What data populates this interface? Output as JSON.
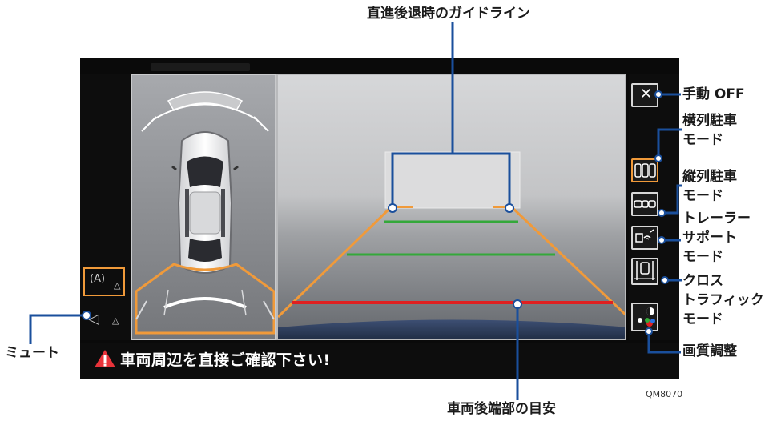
{
  "callouts": {
    "guideline_straight": "直進後退時のガイドライン",
    "manual_off": "手動 OFF",
    "parallel_parking_1": "横列駐車",
    "parallel_parking_2": "モード",
    "series_parking_1": "縦列駐車",
    "series_parking_2": "モード",
    "trailer_support_1": "トレーラー",
    "trailer_support_2": "サポート",
    "trailer_support_3": "モード",
    "cross_traffic_1": "クロス",
    "cross_traffic_2": "トラフィック",
    "cross_traffic_3": "モード",
    "image_quality": "画質調整",
    "mute": "ミュート",
    "rear_end_guide": "車両後端部の目安"
  },
  "screen": {
    "status_text": "車両周辺を直接ご確認下さい!",
    "left_icon_1_label": "(A)",
    "left_icon_2_label": "◁",
    "manual_off_icon": "✕"
  },
  "figure_code": "QM8070",
  "colors": {
    "callout_line": "#1a4f9c",
    "guide_orange": "#f09a3a",
    "guide_green": "#34a83a",
    "guide_red": "#e02020",
    "button_active": "#f09a3a",
    "warning_red": "#e8333a"
  },
  "icons": [
    "close-icon",
    "parallel-parking-icon",
    "series-parking-icon",
    "trailer-icon",
    "cross-traffic-icon",
    "image-quality-icon",
    "auto-icon",
    "speaker-mute-icon",
    "warning-icon"
  ]
}
